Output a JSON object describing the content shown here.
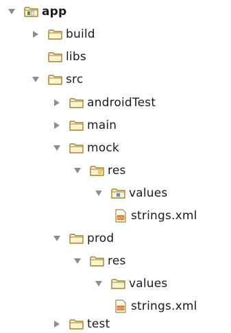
{
  "tree": [
    {
      "label": "app",
      "bold": true,
      "expanded": true,
      "icon": "module-folder-icon"
    },
    {
      "label": "build",
      "expanded": false,
      "icon": "folder-icon"
    },
    {
      "label": "libs",
      "leaf": true,
      "icon": "folder-icon"
    },
    {
      "label": "src",
      "expanded": true,
      "icon": "folder-icon"
    },
    {
      "label": "androidTest",
      "expanded": false,
      "icon": "folder-icon"
    },
    {
      "label": "main",
      "expanded": false,
      "icon": "folder-icon"
    },
    {
      "label": "mock",
      "expanded": true,
      "icon": "folder-icon"
    },
    {
      "label": "res",
      "expanded": true,
      "icon": "resource-folder-icon"
    },
    {
      "label": "values",
      "expanded": true,
      "icon": "package-folder-icon"
    },
    {
      "label": "strings.xml",
      "leaf": true,
      "icon": "xml-file-icon"
    },
    {
      "label": "prod",
      "expanded": true,
      "icon": "folder-icon"
    },
    {
      "label": "res",
      "expanded": true,
      "icon": "folder-icon"
    },
    {
      "label": "values",
      "expanded": true,
      "icon": "folder-icon"
    },
    {
      "label": "strings.xml",
      "leaf": true,
      "icon": "xml-file-icon"
    },
    {
      "label": "test",
      "expanded": false,
      "icon": "folder-icon"
    }
  ],
  "colors": {
    "arrow": "#8c8c8c",
    "folder_fill": "#fdf3cc",
    "folder_stroke": "#a0822d",
    "resource_accent": "#e8b52c",
    "module_accent": "#4f9a3b",
    "package_accent": "#5c8fc9",
    "xml_accent": "#e07a28"
  }
}
